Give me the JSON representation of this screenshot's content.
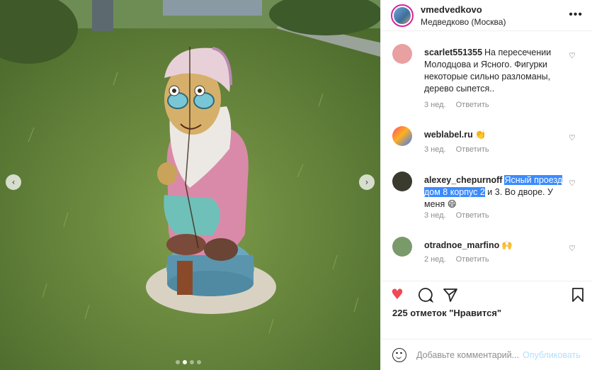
{
  "post": {
    "image_alt": "wooden gnome sculpture on grass",
    "carousel_dots": 4,
    "carousel_active": 2
  },
  "header": {
    "username": "vmedvedkovo",
    "location": "Медведково (Москва)",
    "more_icon": "more-horizontal-icon"
  },
  "comments": [
    {
      "user": "scarlet551355",
      "text": "На пересечении Молодцова и Ясного. Фигурки некоторые сильно разломаны, дерево сыпется..",
      "time": "3 нед.",
      "reply": "Ответить",
      "avatar_color": "#e0605a"
    },
    {
      "user": "weblabel.ru",
      "text": "👏",
      "time": "3 нед.",
      "reply": "Ответить",
      "avatar_color": "#4a3a8a"
    },
    {
      "user": "alexey_chepurnoff",
      "text_highlight": "Ясный проезд дом 8 корпус 2",
      "text_rest": " и 3. Во дворе. У меня 😄",
      "time": "3 нед.",
      "reply": "Ответить",
      "avatar_color": "#3b3a2e"
    },
    {
      "user": "otradnoe_marfino",
      "text": "🙌",
      "time": "2 нед.",
      "reply": "Ответить",
      "avatar_color": "#7a9a6a"
    }
  ],
  "actions": {
    "like_icon": "heart-filled-icon",
    "comment_icon": "comment-icon",
    "share_icon": "share-icon",
    "save_icon": "bookmark-icon",
    "like_color": "#ed4956"
  },
  "likes_text": "225 отметок \"Нравится\"",
  "add_comment": {
    "placeholder": "Добавьте комментарий...",
    "publish_label": "Опубликовать"
  }
}
